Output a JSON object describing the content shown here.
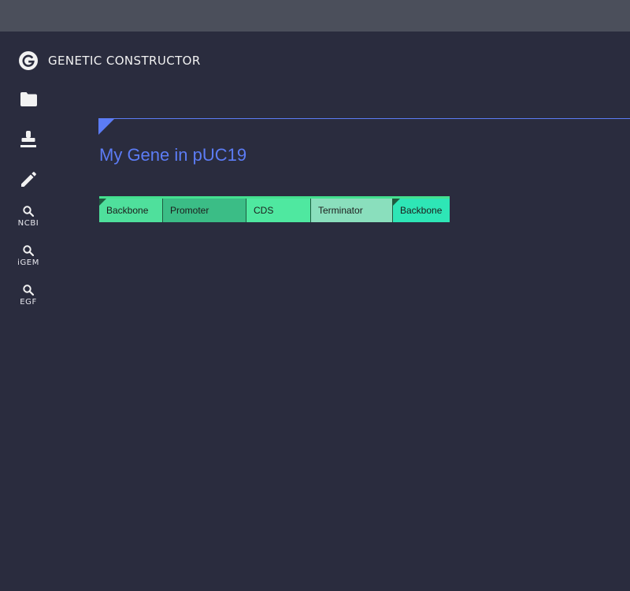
{
  "app": {
    "title": "GENETIC CONSTRUCTOR"
  },
  "sidebar": {
    "items": [
      {
        "icon": "folder-icon",
        "label": ""
      },
      {
        "icon": "stamp-icon",
        "label": ""
      },
      {
        "icon": "pencil-icon",
        "label": ""
      },
      {
        "icon": "search-icon",
        "label": "NCBI"
      },
      {
        "icon": "search-icon",
        "label": "iGEM"
      },
      {
        "icon": "search-icon",
        "label": "EGF"
      }
    ]
  },
  "construct": {
    "title": "My Gene in pUC19",
    "accent_color": "#5c7cf5",
    "blocks": [
      {
        "label": "Backbone",
        "color": "#4fe09c"
      },
      {
        "label": "Promoter",
        "color": "#3bbd86"
      },
      {
        "label": "CDS",
        "color": "#4fe8a0"
      },
      {
        "label": "Terminator",
        "color": "#8adfbd"
      },
      {
        "label": "Backbone",
        "color": "#2ee6b6"
      }
    ]
  }
}
